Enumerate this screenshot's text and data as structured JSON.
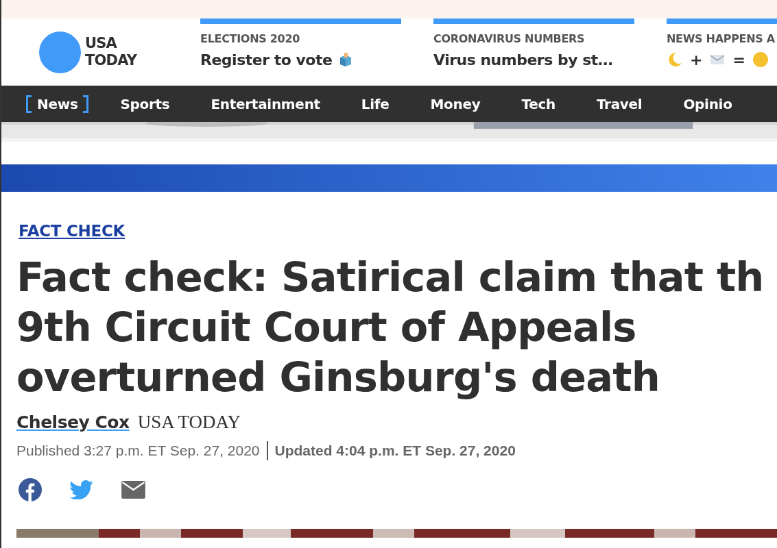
{
  "logo": {
    "line_1": "USA",
    "line_2": "TODAY"
  },
  "promos": [
    {
      "kicker": "ELECTIONS 2020",
      "headline": "Register to vote",
      "kind": "ballot"
    },
    {
      "kicker": "CORONAVIRUS NUMBERS",
      "headline": "Virus numbers by st…",
      "kind": "text"
    },
    {
      "kicker": "NEWS HAPPENS A",
      "kind": "emoji",
      "symbols": [
        "+",
        "="
      ]
    }
  ],
  "nav": [
    {
      "label": "News",
      "selected": true
    },
    {
      "label": "Sports",
      "selected": false
    },
    {
      "label": "Entertainment",
      "selected": false
    },
    {
      "label": "Life",
      "selected": false
    },
    {
      "label": "Money",
      "selected": false
    },
    {
      "label": "Tech",
      "selected": false
    },
    {
      "label": "Travel",
      "selected": false
    },
    {
      "label": "Opinio",
      "selected": false
    }
  ],
  "article": {
    "label": "FACT CHECK",
    "headline_lines": [
      "Fact check: Satirical claim that th",
      "9th Circuit Court of Appeals",
      "overturned Ginsburg's death"
    ],
    "author": "Chelsey Cox",
    "outlet": "USA TODAY",
    "published": "Published 3:27 p.m. ET Sep. 27, 2020",
    "updated": "Updated 4:04 p.m. ET Sep. 27, 2020"
  }
}
